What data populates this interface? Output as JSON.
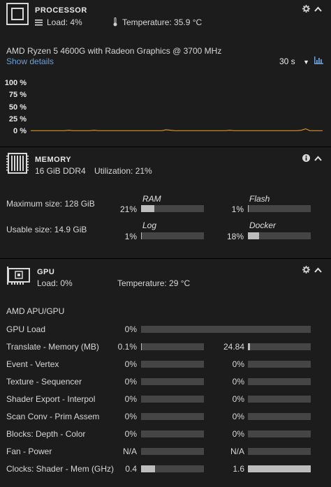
{
  "processor": {
    "title": "PROCESSOR",
    "load": "Load: 4%",
    "temperature": "Temperature: 35.9 °C",
    "model": "AMD Ryzen 5 4600G with Radeon Graphics @ 3700 MHz",
    "show_details": "Show details",
    "interval": "30 s",
    "chart": {
      "ticks": [
        "100 %",
        "75 %",
        "50 %",
        "25 %",
        "0 %"
      ],
      "line_color": "#d4902a"
    }
  },
  "chart_data": {
    "type": "line",
    "title": "",
    "xlabel": "",
    "ylabel": "",
    "ylim": [
      0,
      100
    ],
    "yticks": [
      "100 %",
      "75 %",
      "50 %",
      "25 %",
      "0 %"
    ],
    "series": [
      {
        "values": [
          1,
          1,
          1,
          1,
          1,
          1,
          1,
          1,
          1,
          2,
          1,
          1,
          1,
          1,
          1,
          2,
          1,
          1,
          1,
          1,
          1,
          1,
          1,
          1,
          1,
          1,
          1,
          1,
          1,
          1,
          1,
          1,
          3,
          2,
          1,
          1,
          1,
          1,
          1,
          1,
          1,
          1,
          1,
          1,
          1,
          1,
          1,
          2,
          1,
          1,
          1,
          1,
          1,
          1,
          1,
          1,
          1,
          1,
          1,
          1,
          1,
          1,
          1,
          1,
          2,
          5,
          1,
          1,
          1,
          1
        ]
      }
    ]
  },
  "memory": {
    "title": "MEMORY",
    "type": "16 GiB DDR4",
    "utilization": "Utilization: 21%",
    "max_size": "Maximum size: 128 GiB",
    "usable_size": "Usable size: 14.9 GiB",
    "bars": [
      {
        "label": "RAM",
        "pct": "21%",
        "value": 0.21
      },
      {
        "label": "Flash",
        "pct": "1%",
        "value": 0.01
      },
      {
        "label": "Log",
        "pct": "1%",
        "value": 0.01
      },
      {
        "label": "Docker",
        "pct": "18%",
        "value": 0.18
      }
    ]
  },
  "gpu": {
    "title": "GPU",
    "load": "Load: 0%",
    "temperature": "Temperature: 29 °C",
    "model": "AMD APU/GPU",
    "rows": [
      {
        "label": "GPU Load",
        "left": "0%",
        "left_value": 0.0,
        "right": null,
        "right_value": null
      },
      {
        "label": "Translate - Memory (MB)",
        "left": "0.1%",
        "left_value": 0.001,
        "right": "24.84",
        "right_value": 0.03
      },
      {
        "label": "Event - Vertex",
        "left": "0%",
        "left_value": 0.0,
        "right": "0%",
        "right_value": 0.0
      },
      {
        "label": "Texture - Sequencer",
        "left": "0%",
        "left_value": 0.0,
        "right": "0%",
        "right_value": 0.0
      },
      {
        "label": "Shader Export - Interpol",
        "left": "0%",
        "left_value": 0.0,
        "right": "0%",
        "right_value": 0.0
      },
      {
        "label": "Scan Conv - Prim Assem",
        "left": "0%",
        "left_value": 0.0,
        "right": "0%",
        "right_value": 0.0
      },
      {
        "label": "Blocks: Depth - Color",
        "left": "0%",
        "left_value": 0.0,
        "right": "0%",
        "right_value": 0.0
      },
      {
        "label": "Fan - Power",
        "left": "N/A",
        "left_value": 0.0,
        "right": "N/A",
        "right_value": 0.0
      },
      {
        "label": "Clocks: Shader - Mem (GHz)",
        "left": "0.4",
        "left_value": 0.22,
        "right": "1.6",
        "right_value": 1.0
      }
    ]
  },
  "icons": {
    "gear": "gear-icon",
    "chevron_up": "chevron-up-icon",
    "info": "info-icon",
    "bar_chart": "bar-chart-icon",
    "dropdown": "dropdown-caret-icon",
    "thermometer": "thermometer-icon",
    "load": "load-lines-icon"
  }
}
